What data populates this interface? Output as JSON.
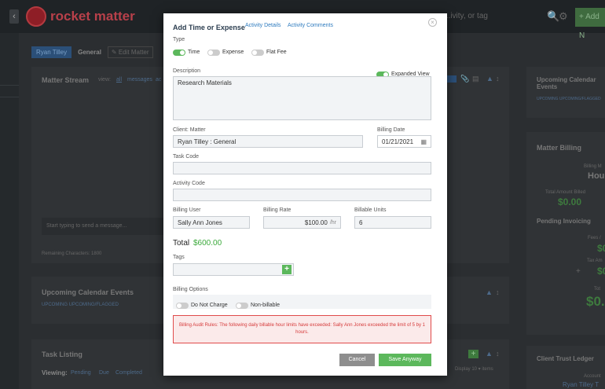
{
  "app": {
    "logo_text": "rocket matter",
    "search_placeholder": "...ivity, or tag",
    "add_label": "+ Add N",
    "back": "‹"
  },
  "breadcrumb": {
    "client": "Ryan Tilley",
    "matter": "General",
    "edit": "✎ Edit Matter"
  },
  "stream": {
    "title": "Matter Stream",
    "view_label": "view:",
    "filters": [
      "all",
      "messages",
      "ac"
    ],
    "message_placeholder": "Start typing to send a message...",
    "remaining": "Remaining Characters: 1800"
  },
  "upcoming_left": {
    "title": "Upcoming Calendar Events",
    "tabs": "UPCOMING   UPCOMING/FLAGGED"
  },
  "tasks": {
    "title": "Task Listing",
    "viewing": "Viewing:",
    "filters": [
      "Pending",
      "Due",
      "Completed"
    ],
    "display": "Display  10 ▾ items"
  },
  "right_col": {
    "upcoming_title": "Upcoming Calendar Events",
    "upcoming_tabs": "UPCOMING   UPCOMING/FLAGGED",
    "billing_title": "Matter Billing",
    "billing_method_lbl": "Billing M",
    "billing_method_val": "Hou",
    "total_billed_lbl": "Total Amount Billed",
    "total_billed_val": "$0.00",
    "pending_title": "Pending Invoicing",
    "fees_lbl": "Fees /",
    "fees_val": "$0",
    "tax_lbl": "Tax Am",
    "tax_val": "$0",
    "total_lbl": "Tot",
    "total_val": "$0.",
    "trust_title": "Client Trust Ledger",
    "account_lbl": "Account",
    "account_val": "Ryan Tilley T"
  },
  "modal": {
    "title": "Add Time or Expense",
    "tab_details": "Activity Details",
    "tab_comments": "Activity Comments",
    "close": "×",
    "type_label": "Type",
    "type_options": [
      "Time",
      "Expense",
      "Flat Fee"
    ],
    "description_label": "Description",
    "expanded_view_label": "Expanded View",
    "description_value": "Research Materials",
    "client_matter_label": "Client: Matter",
    "client_matter_value": "Ryan Tilley : General",
    "billing_date_label": "Billing Date",
    "billing_date_value": "01/21/2021",
    "task_code_label": "Task Code",
    "activity_code_label": "Activity Code",
    "billing_user_label": "Billing User",
    "billing_user_value": "Sally Ann Jones",
    "billing_rate_label": "Billing Rate",
    "billing_rate_value": "$100.00",
    "billing_rate_unit": "/hr",
    "billable_units_label": "Billable Units",
    "billable_units_value": "6",
    "total_label": "Total",
    "total_value": "$600.00",
    "tags_label": "Tags",
    "billing_options_label": "Billing Options",
    "do_not_charge_label": "Do Not Charge",
    "non_billable_label": "Non-billable",
    "alert_text": "Billing Audit Rules: The following daily billable hour limits have exceeded: Sally Ann Jones exceeded the limit of 5 by 1 hours.",
    "cancel_label": "Cancel",
    "save_label": "Save Anyway"
  },
  "colors": {
    "accent_green": "#5cb85c",
    "link_blue": "#2e7bbf",
    "alert_red": "#e04b4b"
  }
}
